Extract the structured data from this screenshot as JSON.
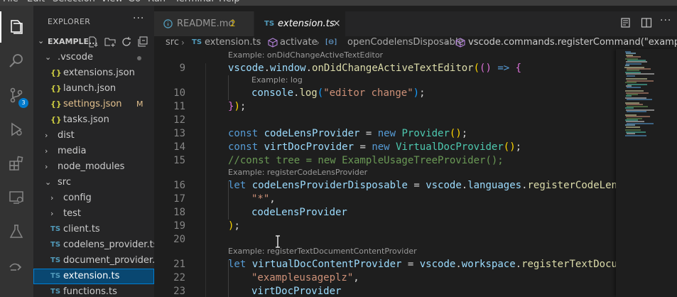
{
  "menubar": [
    "File",
    "Edit",
    "Selection",
    "View",
    "Go",
    "Run",
    "Terminal",
    "Help"
  ],
  "activity_bar": [
    {
      "name": "explorer",
      "icon": "files-icon"
    },
    {
      "name": "search",
      "icon": "search-icon"
    },
    {
      "name": "source-control",
      "icon": "source-control-icon",
      "badge": "3"
    },
    {
      "name": "run-debug",
      "icon": "debug-icon"
    },
    {
      "name": "extensions",
      "icon": "extensions-icon"
    },
    {
      "name": "remote-explorer",
      "icon": "remote-explorer-icon"
    },
    {
      "name": "testing",
      "icon": "flask-icon"
    },
    {
      "name": "remote",
      "icon": "remote-icon"
    }
  ],
  "sidebar": {
    "title": "EXPLORER",
    "more": "···",
    "folder_name": "EXAMPLE...",
    "tree": [
      {
        "label": ".vscode",
        "kind": "folder",
        "open": true,
        "depth": 1,
        "dot": true
      },
      {
        "label": "extensions.json",
        "kind": "json",
        "depth": 2
      },
      {
        "label": "launch.json",
        "kind": "json",
        "depth": 2
      },
      {
        "label": "settings.json",
        "kind": "json",
        "depth": 2,
        "badge": "M",
        "color": "#e2c08d"
      },
      {
        "label": "tasks.json",
        "kind": "json",
        "depth": 2
      },
      {
        "label": "dist",
        "kind": "folder",
        "open": false,
        "depth": 1
      },
      {
        "label": "media",
        "kind": "folder",
        "open": false,
        "depth": 1
      },
      {
        "label": "node_modules",
        "kind": "folder",
        "open": false,
        "depth": 1
      },
      {
        "label": "src",
        "kind": "folder",
        "open": true,
        "depth": 1
      },
      {
        "label": "config",
        "kind": "folder",
        "open": false,
        "depth": 2
      },
      {
        "label": "test",
        "kind": "folder",
        "open": false,
        "depth": 2
      },
      {
        "label": "client.ts",
        "kind": "ts",
        "depth": 2
      },
      {
        "label": "codelens_provider.ts",
        "kind": "ts",
        "depth": 2
      },
      {
        "label": "document_provider....",
        "kind": "ts",
        "depth": 2
      },
      {
        "label": "extension.ts",
        "kind": "ts",
        "depth": 2,
        "selected": true
      },
      {
        "label": "functions.ts",
        "kind": "ts",
        "depth": 2
      }
    ]
  },
  "tabs": [
    {
      "label": "README.md",
      "icon": "info-icon",
      "count": "2",
      "active": false
    },
    {
      "label": "extension.ts",
      "icon": "TS",
      "active": true,
      "close": "×"
    }
  ],
  "breadcrumb": {
    "items": [
      "src",
      "extension.ts",
      "activate",
      "openCodelensDisposable",
      "vscode.commands.registerCommand(\"exampleusa"
    ],
    "ts_badge": "TS"
  },
  "editor": {
    "lines": [
      {
        "n": "9",
        "lens": "Example: onDidChangeActiveTextEditor",
        "indent": 0,
        "tokens": [
          [
            "v",
            "vscode"
          ],
          [
            "p",
            "."
          ],
          [
            "v",
            "window"
          ],
          [
            "p",
            "."
          ],
          [
            "f",
            "onDidChangeActiveTextEditor"
          ],
          [
            "b0",
            "("
          ],
          [
            "b1",
            "("
          ],
          [
            "b1",
            ")"
          ],
          [
            "p",
            " "
          ],
          [
            "k",
            "=>"
          ],
          [
            "p",
            " "
          ],
          [
            "b1",
            "{"
          ]
        ]
      },
      {
        "n": "10",
        "lens": "Example: log",
        "indent": 1,
        "tokens": [
          [
            "v",
            "console"
          ],
          [
            "p",
            "."
          ],
          [
            "f",
            "log"
          ],
          [
            "b2",
            "("
          ],
          [
            "s",
            "\"editor change\""
          ],
          [
            "b2",
            ")"
          ],
          [
            "p",
            ";"
          ]
        ]
      },
      {
        "n": "11",
        "indent": 0,
        "tokens": [
          [
            "b1",
            "}"
          ],
          [
            "b0",
            ")"
          ],
          [
            "p",
            ";"
          ]
        ]
      },
      {
        "n": "12",
        "indent": 0,
        "tokens": []
      },
      {
        "n": "13",
        "indent": 0,
        "tokens": [
          [
            "k",
            "const"
          ],
          [
            "p",
            " "
          ],
          [
            "v",
            "codeLensProvider"
          ],
          [
            "p",
            " = "
          ],
          [
            "k",
            "new"
          ],
          [
            "p",
            " "
          ],
          [
            "t",
            "Provider"
          ],
          [
            "b0",
            "("
          ],
          [
            "b0",
            ")"
          ],
          [
            "p",
            ";"
          ]
        ]
      },
      {
        "n": "14",
        "indent": 0,
        "tokens": [
          [
            "k",
            "const"
          ],
          [
            "p",
            " "
          ],
          [
            "v",
            "virtDocProvider"
          ],
          [
            "p",
            " = "
          ],
          [
            "k",
            "new"
          ],
          [
            "p",
            " "
          ],
          [
            "t",
            "VirtualDocProvider"
          ],
          [
            "b0",
            "("
          ],
          [
            "b0",
            ")"
          ],
          [
            "p",
            ";"
          ]
        ]
      },
      {
        "n": "15",
        "indent": 0,
        "tokens": [
          [
            "c",
            "//const tree = new ExampleUsageTreeProvider();"
          ]
        ]
      },
      {
        "n": "16",
        "lens": "Example: registerCodeLensProvider",
        "indent": 0,
        "tokens": [
          [
            "k",
            "let"
          ],
          [
            "p",
            " "
          ],
          [
            "v",
            "codeLensProviderDisposable"
          ],
          [
            "p",
            " = "
          ],
          [
            "v",
            "vscode"
          ],
          [
            "p",
            "."
          ],
          [
            "v",
            "languages"
          ],
          [
            "p",
            "."
          ],
          [
            "f",
            "registerCodeLensProvider"
          ],
          [
            "b0",
            "("
          ]
        ]
      },
      {
        "n": "17",
        "indent": 1,
        "tokens": [
          [
            "s",
            "\"*\""
          ],
          [
            "p",
            ","
          ]
        ]
      },
      {
        "n": "18",
        "indent": 1,
        "tokens": [
          [
            "v",
            "codeLensProvider"
          ]
        ]
      },
      {
        "n": "19",
        "indent": 0,
        "tokens": [
          [
            "b0",
            ")"
          ],
          [
            "p",
            ";"
          ]
        ]
      },
      {
        "n": "20",
        "indent": 0,
        "tokens": []
      },
      {
        "n": "21",
        "lens": "Example: registerTextDocumentContentProvider",
        "indent": 0,
        "tokens": [
          [
            "k",
            "let"
          ],
          [
            "p",
            " "
          ],
          [
            "v",
            "virtualDocContentProvider"
          ],
          [
            "p",
            " = "
          ],
          [
            "v",
            "vscode"
          ],
          [
            "p",
            "."
          ],
          [
            "v",
            "workspace"
          ],
          [
            "p",
            "."
          ],
          [
            "f",
            "registerTextDocumentContentProvider"
          ],
          [
            "b0",
            "("
          ]
        ]
      },
      {
        "n": "22",
        "indent": 1,
        "tokens": [
          [
            "s",
            "\"exampleusageplz\""
          ],
          [
            "p",
            ","
          ]
        ]
      },
      {
        "n": "23",
        "indent": 1,
        "tokens": [
          [
            "v",
            "virtDocProvider"
          ]
        ]
      }
    ]
  },
  "colors": {
    "accent": "#007acc",
    "keyword": "#569cd6",
    "variable": "#9cdcfe",
    "function": "#dcdcaa",
    "string": "#ce9178",
    "comment": "#6a9955",
    "type": "#4ec9b0",
    "modified": "#e2c08d",
    "selected_bg": "#094771"
  }
}
